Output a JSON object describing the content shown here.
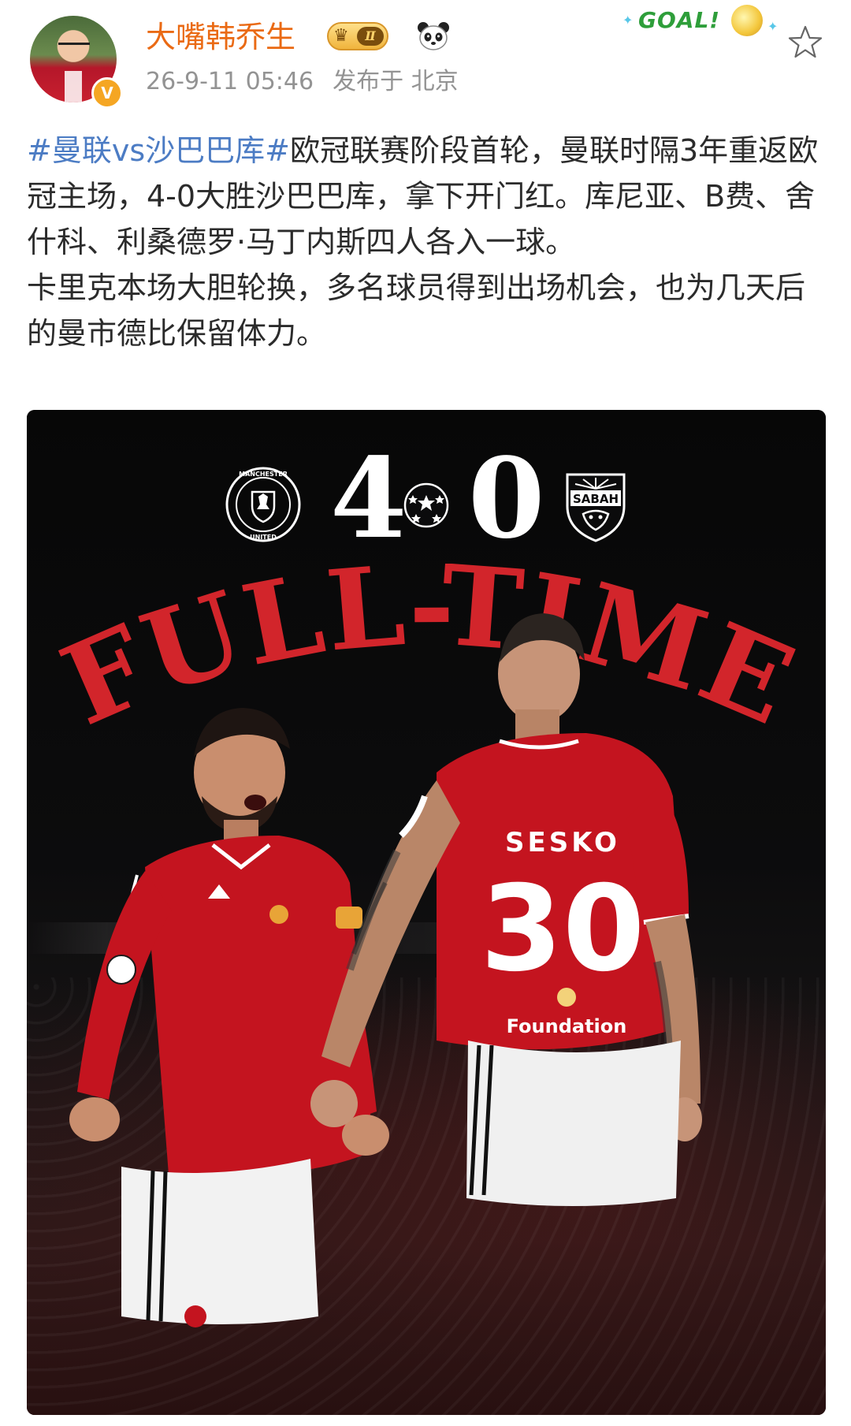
{
  "post": {
    "author": "大嘴韩乔生",
    "level": "Ⅱ",
    "verified_mark": "V",
    "time": "26-9-11 05:46",
    "location": "发布于 北京",
    "sticker_text": "GOAL!",
    "hashtag": "#曼联vs沙巴巴库#",
    "paragraph1_rest": "欧冠联赛阶段首轮，曼联时隔3年重返欧冠主场，4-0大胜沙巴巴库，拿下开门红。库尼亚、B费、舍什科、利桑德罗·马丁内斯四人各入一球。",
    "paragraph2": "卡里克本场大胆轮换，多名球员得到出场机会，也为几天后的曼市德比保留体力。"
  },
  "poster": {
    "home_crest_text": "MANCHESTER UNITED",
    "away_crest_text": "SABAH",
    "home_score": "4",
    "away_score": "0",
    "headline": "FULL-TIME",
    "player_name": "SESKO",
    "player_number": "30",
    "sponsor_text": "Foundation"
  },
  "colors": {
    "author": "#ea6a14",
    "hashtag": "#4c7cc4",
    "timestamp": "#939393",
    "headline_red": "#d2252b",
    "kit_red": "#c4141f"
  },
  "icons": {
    "avatar": "user-avatar",
    "verified": "verified-badge-icon",
    "crown": "crown-icon",
    "panda": "panda-icon",
    "star": "star-icon",
    "ucl_ball": "champions-league-ball-icon"
  }
}
